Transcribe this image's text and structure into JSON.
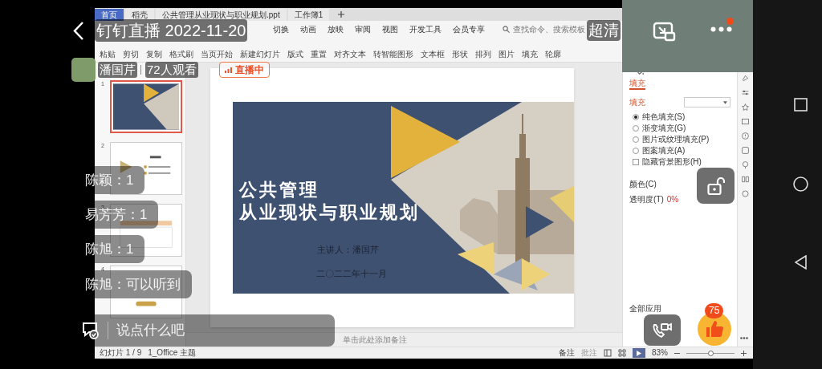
{
  "live": {
    "title": "钉钉直播 2022-11-20",
    "host": "潘国芹",
    "viewers": "72人观看",
    "badge": "直播中",
    "quality": "超清"
  },
  "wps": {
    "tabs": [
      {
        "label": "首页",
        "selected": true
      },
      {
        "label": "稻壳",
        "selected": false
      },
      {
        "label": "公共管理从业现状与职业规划.ppt",
        "selected": false
      },
      {
        "label": "工作簿1",
        "selected": false
      }
    ],
    "ribbon_tabs": [
      "切换",
      "动画",
      "放映",
      "审阅",
      "视图",
      "开发工具",
      "会员专享"
    ],
    "search": {
      "placeholder": "查找命令、搜索模板"
    },
    "toolbar": [
      "粘贴",
      "剪切",
      "复制",
      "格式刷",
      "当页开始",
      "新建幻灯片",
      "版式",
      "重置",
      "对齐文本",
      "转智能图形",
      "文本框",
      "形状",
      "排列",
      "图片",
      "填充",
      "轮廓"
    ],
    "slides": [
      {
        "number": "1",
        "selected": true
      },
      {
        "number": "2",
        "selected": false
      },
      {
        "number": "3",
        "selected": false
      },
      {
        "number": "4",
        "selected": false
      }
    ],
    "slide": {
      "title_lines": [
        "公共管理",
        "从业现状与职业规划"
      ],
      "presenter": "主讲人：潘国芹",
      "date": "二〇二二年十一月"
    },
    "notes_placeholder": "单击此处添加备注",
    "status": {
      "slide_count": "幻灯片 1 / 9",
      "theme": "1_Office 主题",
      "notes": "备注",
      "comments": "批注",
      "zoom": "83%",
      "level": 0.5
    },
    "pane": {
      "tab": "填充",
      "section": "填充",
      "fill_options": [
        {
          "label": "纯色填充(S)",
          "selected": true
        },
        {
          "label": "渐变填充(G)",
          "selected": false
        },
        {
          "label": "图片或纹理填充(P)",
          "selected": false
        },
        {
          "label": "图案填充(A)",
          "selected": false
        }
      ],
      "hide_background": {
        "label": "隐藏背景图形(H)",
        "checked": false
      },
      "color_label": "颜色(C)",
      "transparency_label": "透明度(T)",
      "transparency_value": "0%",
      "apply_all": "全部应用"
    }
  },
  "comments": [
    {
      "text": "陈颖：1"
    },
    {
      "text": "易芳芳：1"
    },
    {
      "text": "陈旭：1"
    },
    {
      "text": "陈旭：可以听到"
    }
  ],
  "input": {
    "placeholder": "说点什么吧"
  },
  "likes": "75"
}
